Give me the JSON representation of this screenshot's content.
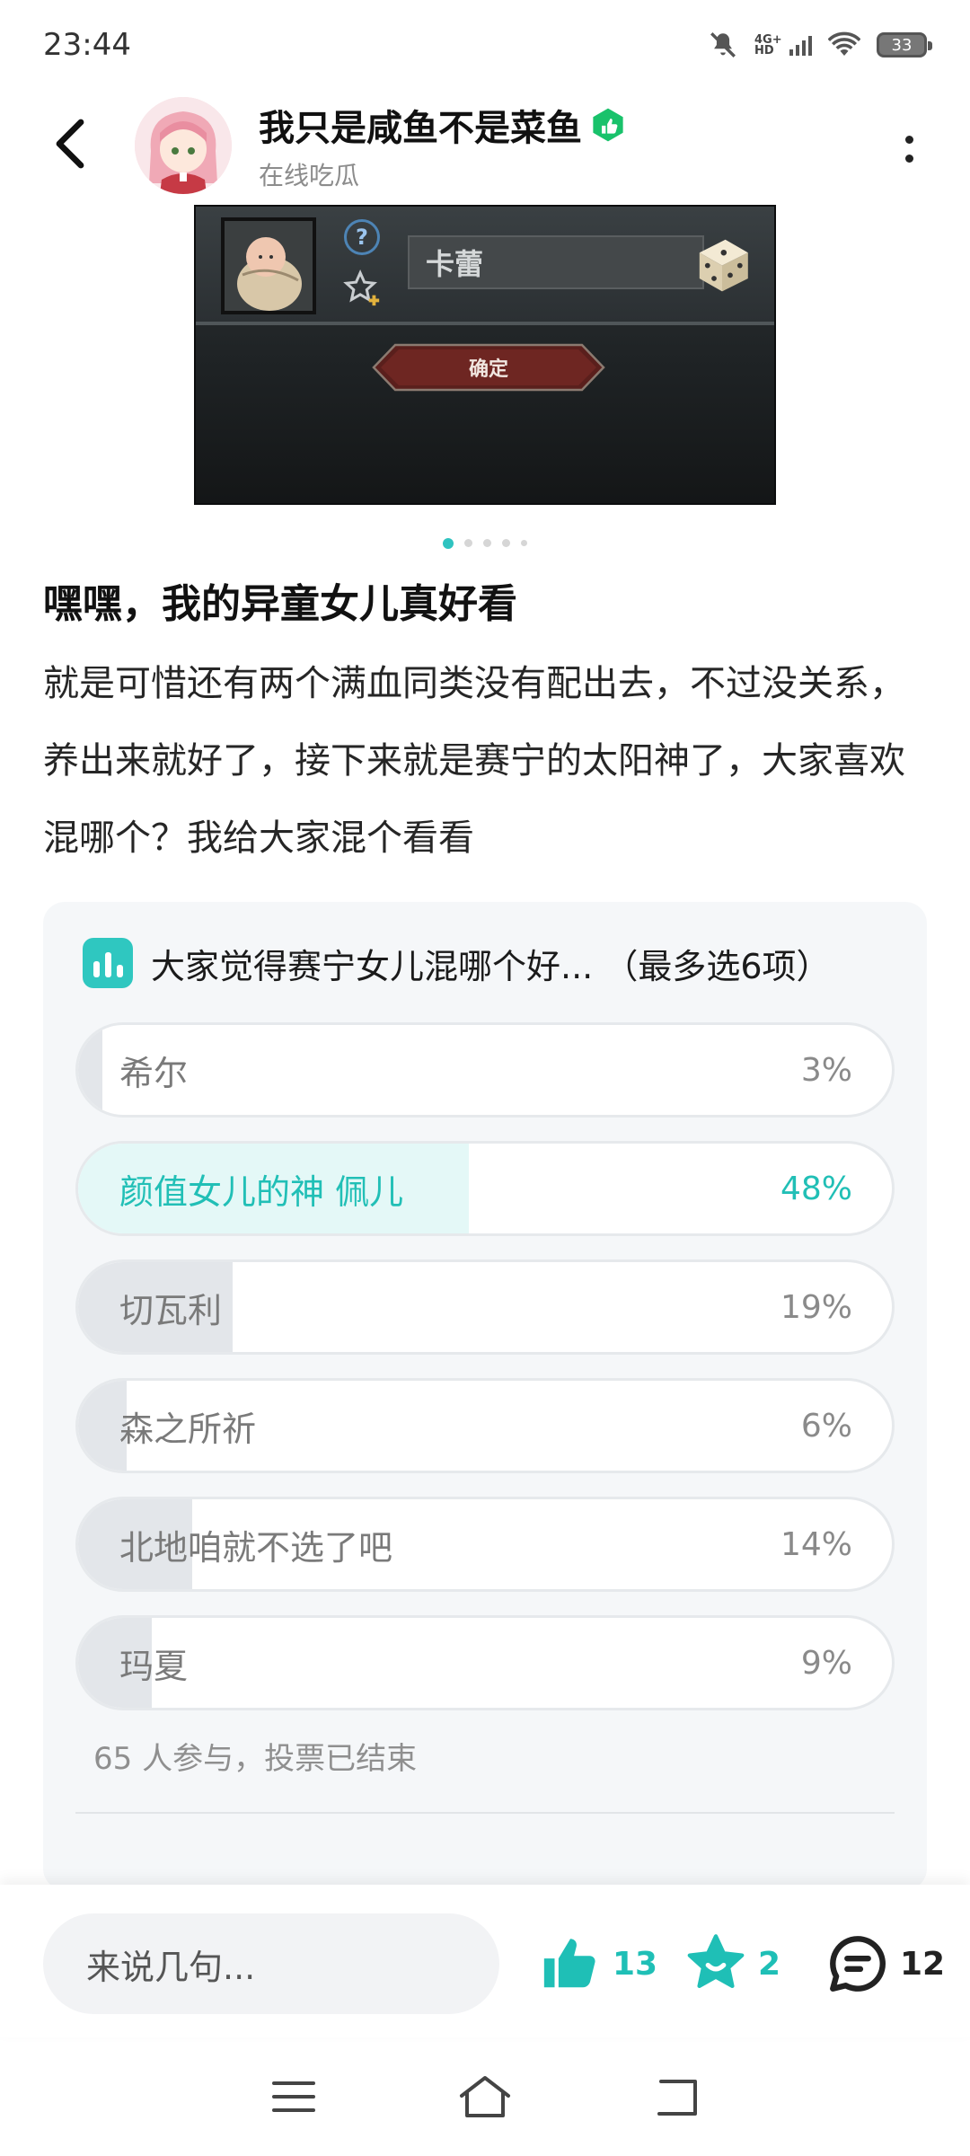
{
  "status_bar": {
    "time": "23:44",
    "network": "4G+ HD",
    "battery": "33"
  },
  "header": {
    "user_name": "我只是咸鱼不是菜鱼",
    "user_status": "在线吃瓜"
  },
  "post_image": {
    "name_field": "卡蕾",
    "confirm_label": "确定",
    "page_count": 5,
    "active_page": 1
  },
  "post": {
    "title": "嘿嘿，我的异童女儿真好看",
    "body": "就是可惜还有两个满血同类没有配出去，不过没关系，养出来就好了，接下来就是赛宁的太阳神了，大家喜欢混哪个？我给大家混个看看"
  },
  "poll": {
    "title": "大家觉得赛宁女儿混哪个好... （最多选6项）",
    "options": [
      {
        "label": "希尔",
        "percent": "3%",
        "value": 3,
        "selected": false
      },
      {
        "label": "颜值女儿的神 佩儿",
        "percent": "48%",
        "value": 48,
        "selected": true
      },
      {
        "label": "切瓦利",
        "percent": "19%",
        "value": 19,
        "selected": false
      },
      {
        "label": "森之所祈",
        "percent": "6%",
        "value": 6,
        "selected": false
      },
      {
        "label": "北地咱就不选了吧",
        "percent": "14%",
        "value": 14,
        "selected": false
      },
      {
        "label": "玛夏",
        "percent": "9%",
        "value": 9,
        "selected": false
      }
    ],
    "footer": "65 人参与，投票已结束"
  },
  "bottom_bar": {
    "comment_placeholder": "来说几句...",
    "like_count": "13",
    "favorite_count": "2",
    "comment_count": "12"
  },
  "colors": {
    "accent": "#1fbfb6",
    "badge_green": "#19c26b"
  }
}
